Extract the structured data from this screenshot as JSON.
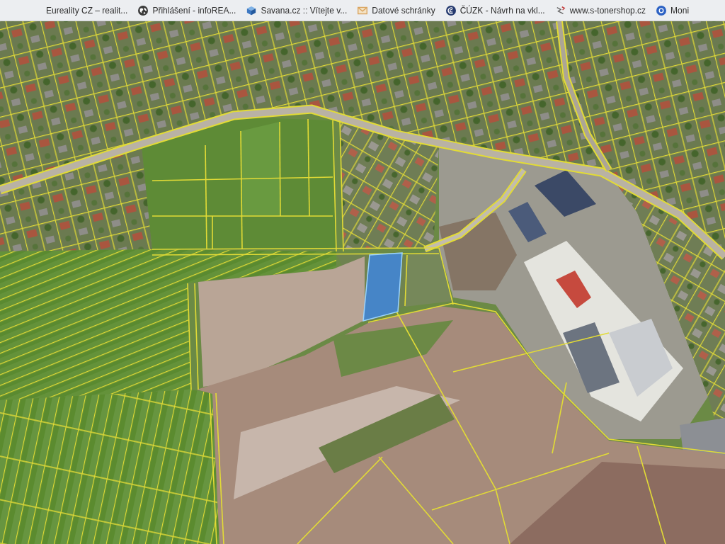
{
  "bookmarks_bar": {
    "items": [
      {
        "label": "Eureality CZ – realit..."
      },
      {
        "label": "Přihlášení - infoREA..."
      },
      {
        "label": "Savana.cz :: Vítejte v..."
      },
      {
        "label": "Datové schránky"
      },
      {
        "label": "ČÚZK - Návrh na vkl..."
      },
      {
        "label": "www.s-tonershop.cz"
      },
      {
        "label": "Moni"
      }
    ]
  },
  "map": {
    "parcel_highlighted": true
  }
}
